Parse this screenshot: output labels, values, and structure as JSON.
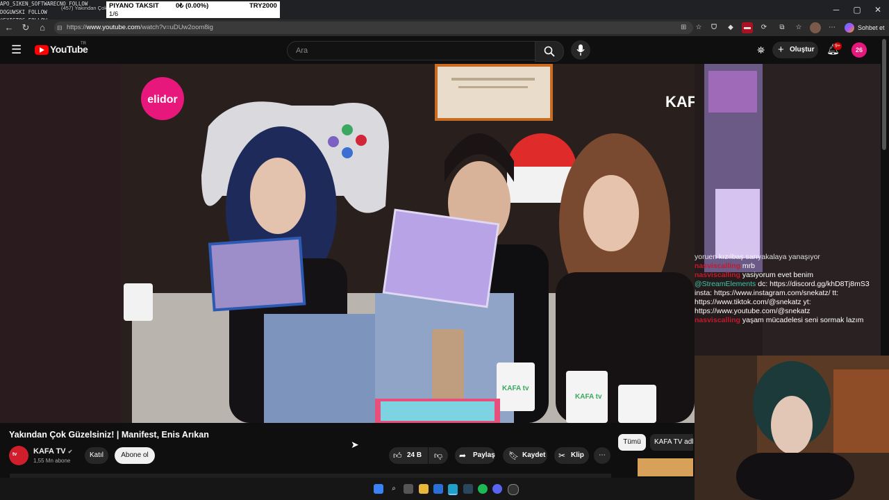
{
  "overlay": {
    "ticker_lines": [
      "APO_SIKEN_SOFTWARECNO FOLLOW",
      "DOGUWSKI FOLLOW",
      "@EXISTOC FOLLOW"
    ],
    "tab_fragment": "(457) Yakından Çok",
    "piano": {
      "name": "PIYANO TAKSIT",
      "amount": "0₺ (0.00%)",
      "goal": "TRY2000",
      "count": "1/6"
    }
  },
  "browser": {
    "url_prefix": "https://",
    "url_host": "www.youtube.com",
    "url_path": "/watch?v=uDUw2oom8ig",
    "chat_button": "Sohbet et"
  },
  "youtube": {
    "logo": "YouTube",
    "region": "TR",
    "search_placeholder": "Ara",
    "create_label": "Oluştur",
    "notif_badge": "9+",
    "avatar_text": "26"
  },
  "video": {
    "title": "Yakından Çok Güzelsiniz! | Manifest, Enis Arıkan",
    "brand_left": "elidor",
    "brand_right": "KAFA tv",
    "mug_logo": "KAFA tv"
  },
  "channel": {
    "name": "KAFA TV",
    "subs": "1,55 Mn abone",
    "join": "Katıl",
    "subscribe": "Abone ol"
  },
  "actions": {
    "likes": "24 B",
    "share": "Paylaş",
    "save": "Kaydet",
    "clip": "Klip"
  },
  "filters": [
    "Tümü",
    "KAFA TV adlı"
  ],
  "stream_chat": [
    {
      "user": "",
      "msg": "yoruen kızılbaş sarıyakalaya yanaşıyor"
    },
    {
      "user": "nasviscalling",
      "msg": "mrb"
    },
    {
      "user": "nasviscalling",
      "msg": "yasiyorum evet benim"
    },
    {
      "user": "@StreamElements",
      "msg": "dc: https://discord.gg/khD8Tj8mS3 insta: https://www.instagram.com/snekatz/ tt: https://www.tiktok.com/@snekatz yt: https://www.youtube.com/@snekatz"
    },
    {
      "user": "nasviscalling",
      "msg": "yaşam mücadelesi seni sormak lazım"
    }
  ],
  "colors": {
    "yt_red": "#ff0000",
    "elidor_pink": "#e8177c",
    "accent_purple": "#b7a3e6"
  }
}
